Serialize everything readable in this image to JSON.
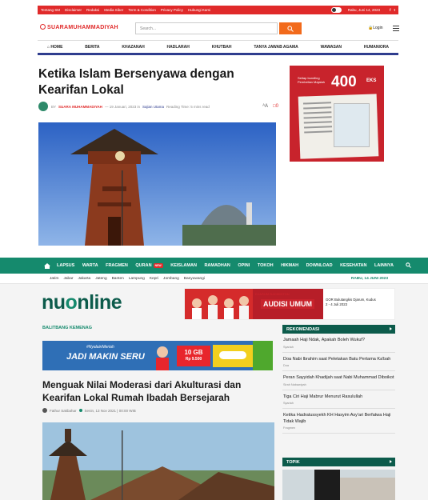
{
  "s1": {
    "topbar": {
      "links": [
        "Tentang SM",
        "Disclaimer",
        "Redaksi",
        "Media Siber",
        "Term & Condition",
        "Privacy Policy",
        "Hubungi Kami"
      ],
      "date": "Rabu, Juni 14, 2023",
      "social": [
        "f",
        "t"
      ]
    },
    "logo": "SUARAMUHAMMADIYAH",
    "search_placeholder": "Search...",
    "login_label": "Login",
    "nav": [
      "HOME",
      "BERITA",
      "KHAZANAH",
      "HADLARAH",
      "KHUTBAH",
      "TANYA JAWAB AGAMA",
      "WAWASAN",
      "HUMANIORA"
    ],
    "article": {
      "title": "Ketika Islam Bersenyawa dengan Kearifan Lokal",
      "by": "BY",
      "author": "SUARA MUHAMMADIYAH",
      "date": "19 Januari, 2023",
      "in": "in",
      "category": "Sajian Utama",
      "reading_time": "Reading Time: 5 mins read",
      "font_icon": "A",
      "comments": "0"
    },
    "ad": {
      "line1": "Setiap bundling Pembelian Majalah",
      "number": "400",
      "unit": "EKS"
    }
  },
  "s2": {
    "nav": [
      "LAPSUS",
      "WARTA",
      "FRAGMEN",
      "QURAN",
      "KEISLAMAN",
      "RAMADHAN",
      "OPINI",
      "TOKOH",
      "HIKMAH",
      "DOWNLOAD",
      "KESEHATAN",
      "LAINNYA"
    ],
    "new_badge": "NEW",
    "regions": [
      "Jatim",
      "Jabar",
      "Jakarta",
      "Jateng",
      "Banten",
      "Lampung",
      "Kepri",
      "Jombang",
      "Banyuwangi"
    ],
    "date": "RABU, 14 JUNI 2023",
    "logo_a": "nu",
    "logo_o": "o",
    "logo_b": "nline",
    "banner": {
      "top": "DJARUM BADMINTON",
      "main": "AUDISI UMUM",
      "right": "GOR Bulutangkis Djarum, Kudus\n2 - 4 Juli 2023"
    },
    "crumb": "BALITBANG KEMENAG",
    "ad": {
      "hashtag": "#NyalainMeriah",
      "headline": "JADI MAKIN SERU",
      "gb": "10 GB",
      "price": "Rp 9.500"
    },
    "article": {
      "title": "Menguak Nilai Moderasi dari Akulturasi dan Kearifan Lokal Rumah Ibadah Bersejarah",
      "author": "Fathur Sakbahar",
      "date": "Senin, 13 Nov 2021 | 00:00 WIB"
    },
    "recommend_title": "REKOMENDASI",
    "recommend": [
      {
        "title": "Jamaah Haji Ndak, Apakah Boleh Wukuf?",
        "cat": "Syariah"
      },
      {
        "title": "Doa Nabi Ibrahim saat Peletakan Batu Pertama Ka'bah",
        "cat": "Doa"
      },
      {
        "title": "Peran Sayyidah Khadijah saat Nabi Muhammad Diboikot",
        "cat": "Sirah Nabawiyah"
      },
      {
        "title": "Tiga Ciri Haji Mabrur Menurut Rasulullah",
        "cat": "Syariah"
      },
      {
        "title": "Ketika Hadratussyekh KH Hasyim Asy'ari Berfatwa Haji Tidak Wajib",
        "cat": "Fragmen"
      }
    ],
    "topik_title": "TOPIK"
  }
}
